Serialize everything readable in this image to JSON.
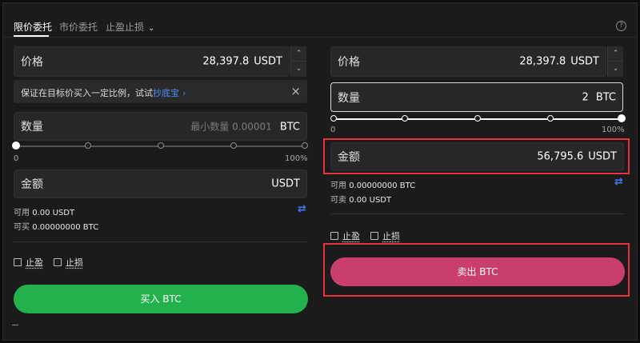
{
  "tabs": [
    {
      "label": "限价委托",
      "active": true
    },
    {
      "label": "市价委托",
      "active": false
    },
    {
      "label": "止盈止损",
      "active": false,
      "dropdown": true
    }
  ],
  "help_icon": "question-circle-icon",
  "left": {
    "price": {
      "label": "价格",
      "value": "28,397.8",
      "unit": "USDT"
    },
    "tip": {
      "text": "保证在目标价买入一定比例，试试",
      "link": "抄底宝",
      "arrow": "›",
      "close": "×"
    },
    "quantity": {
      "label": "数量",
      "placeholder": "最小数量 0.00001",
      "unit": "BTC"
    },
    "slider": {
      "value_pct": 0,
      "min_label": "0",
      "max_label": "100%"
    },
    "amount": {
      "label": "金额",
      "value": "",
      "unit": "USDT"
    },
    "available": {
      "label": "可用",
      "value": "0.00 USDT"
    },
    "can_buy": {
      "label": "可买",
      "value": "0.00000000 BTC"
    },
    "take_profit": "止盈",
    "stop_loss": "止损",
    "button": "买入 BTC"
  },
  "right": {
    "price": {
      "label": "价格",
      "value": "28,397.8",
      "unit": "USDT"
    },
    "quantity": {
      "label": "数量",
      "value": "2",
      "unit": "BTC"
    },
    "slider": {
      "value_pct": 100,
      "min_label": "0",
      "max_label": "100%"
    },
    "amount": {
      "label": "金额",
      "value": "56,795.6",
      "unit": "USDT"
    },
    "available": {
      "label": "可用",
      "value": "0.00000000 BTC"
    },
    "can_sell": {
      "label": "可卖",
      "value": "0.00 USDT"
    },
    "take_profit": "止盈",
    "stop_loss": "止损",
    "button": "卖出 BTC"
  },
  "colors": {
    "buy": "#22b14c",
    "sell": "#c93e6b",
    "accent": "#3f7cf0",
    "highlight": "#e5323c"
  }
}
